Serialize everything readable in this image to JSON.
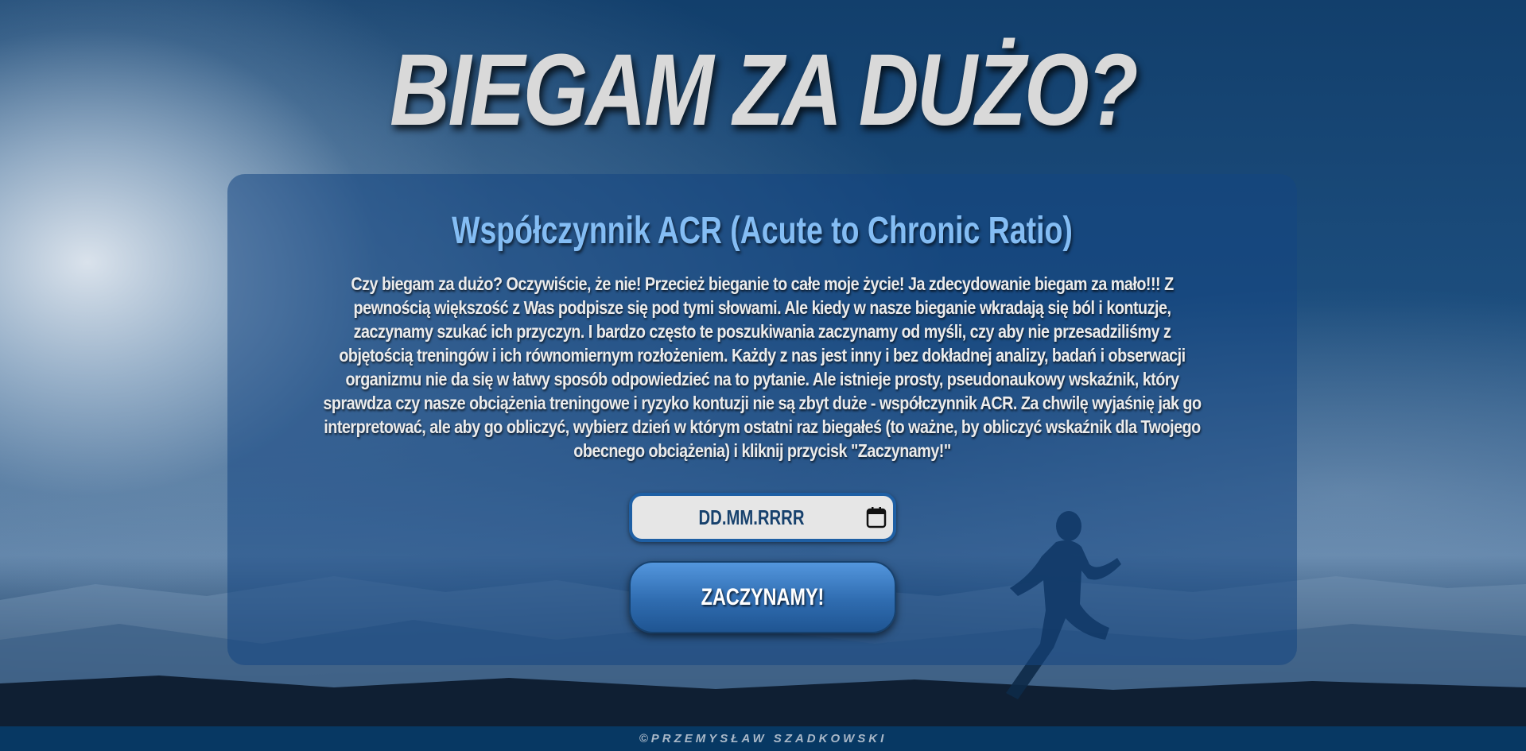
{
  "header": {
    "title": "BIEGAM ZA DUŻO?"
  },
  "card": {
    "title": "Współczynnik ACR (Acute to Chronic Ratio)",
    "description": "Czy biegam za dużo? Oczywiście, że nie! Przecież bieganie to całe moje życie! Ja zdecydowanie biegam za mało!!! Z pewnością większość z Was podpisze się pod tymi słowami. Ale kiedy w nasze bieganie wkradają się ból i kontuzje, zaczynamy szukać ich przyczyn. I bardzo często te poszukiwania zaczynamy od myśli, czy aby nie przesadziliśmy z objętością treningów i ich równomiernym rozłożeniem. Każdy z nas jest inny i bez dokładnej analizy, badań i obserwacji organizmu nie da się w łatwy sposób odpowiedzieć na to pytanie. Ale istnieje prosty, pseudonaukowy wskaźnik, który sprawdza czy nasze obciążenia treningowe i ryzyko kontuzji nie są zbyt duże - współczynnik ACR. Za chwilę wyjaśnię jak go interpretować, ale aby go obliczyć, wybierz dzień w którym ostatni raz biegałeś (to ważne, by obliczyć wskaźnik dla Twojego obecnego obciążenia) i kliknij przycisk \"Zaczynamy!\"",
    "date_input": {
      "placeholder": "DD.MM.RRRR",
      "value": "",
      "icon": "calendar-icon"
    },
    "start_button_label": "ZACZYNAMY!"
  },
  "footer": {
    "text": "©PRZEMYSŁAW SZADKOWSKI"
  },
  "colors": {
    "card_title": "#84bdf4",
    "button_blue": "#2f6cb0",
    "footer_bg": "#073863",
    "input_border": "#1e5fa4"
  }
}
